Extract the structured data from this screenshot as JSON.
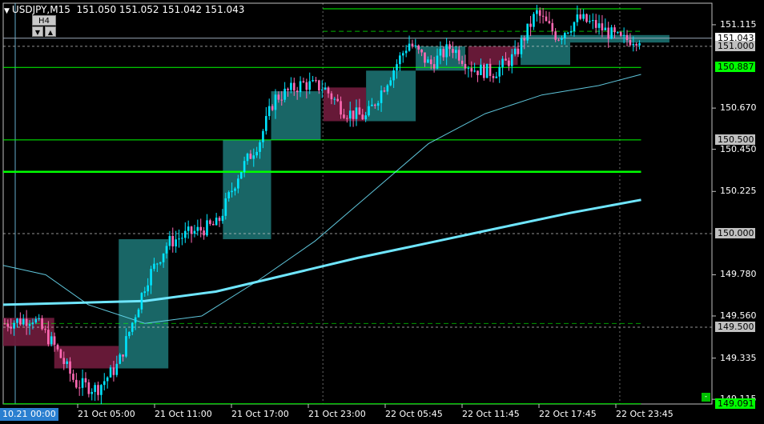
{
  "header": {
    "symbol_tf": "USDJPY,M15",
    "ohlc": "151.050 151.052 151.042 151.043"
  },
  "tf_panel": {
    "tf": "H4",
    "down": "▼",
    "up": "▲"
  },
  "price_axis": {
    "ticks": [
      "151.115",
      "150.670",
      "150.450",
      "150.225",
      "149.780",
      "149.560",
      "149.335",
      "149.115"
    ],
    "boxes": [
      {
        "text": "151.043",
        "fg": "#000000",
        "bg": "#ffffff"
      },
      {
        "text": "151.000",
        "fg": "#000000",
        "bg": "#c0c0c0"
      },
      {
        "text": "150.887",
        "fg": "#000000",
        "bg": "#00ff00"
      },
      {
        "text": "150.500",
        "fg": "#000000",
        "bg": "#c0c0c0"
      },
      {
        "text": "150.000",
        "fg": "#000000",
        "bg": "#c0c0c0"
      },
      {
        "text": "149.500",
        "fg": "#000000",
        "bg": "#c0c0c0"
      },
      {
        "text": "149.091",
        "fg": "#000000",
        "bg": "#00ff00"
      }
    ]
  },
  "time_axis": {
    "current": "10.21 00:00",
    "labels": [
      "21 Oct 05:00",
      "21 Oct 11:00",
      "21 Oct 17:00",
      "21 Oct 23:00",
      "22 Oct 05:45",
      "22 Oct 11:45",
      "22 Oct 17:45",
      "22 Oct 23:45"
    ]
  },
  "corner_button": "-",
  "colors": {
    "bull": "#00e5ff",
    "bear": "#ff69b4",
    "h4_bull": "#1a6b6b",
    "h4_bear": "#6b1a3a",
    "level": "#00ff00",
    "ma": "#6fe6ff"
  },
  "chart_data": {
    "type": "candlestick",
    "symbol": "USDJPY",
    "timeframe": "M15",
    "ylim": [
      149.09,
      151.23
    ],
    "last_price": 151.043,
    "horizontal_levels": [
      151.2,
      151.0,
      150.887,
      150.5,
      150.33,
      150.0,
      149.5,
      149.091
    ],
    "h4_boxes": [
      {
        "x0": 0.0,
        "x1": 0.072,
        "open": 149.55,
        "close": 149.4,
        "dir": "bear"
      },
      {
        "x0": 0.072,
        "x1": 0.163,
        "open": 149.4,
        "close": 149.28,
        "dir": "bear"
      },
      {
        "x0": 0.163,
        "x1": 0.233,
        "open": 149.28,
        "close": 149.97,
        "dir": "bull"
      },
      {
        "x0": 0.31,
        "x1": 0.378,
        "open": 149.97,
        "close": 150.5,
        "dir": "bull"
      },
      {
        "x0": 0.378,
        "x1": 0.448,
        "open": 150.5,
        "close": 150.76,
        "dir": "bull"
      },
      {
        "x0": 0.452,
        "x1": 0.512,
        "open": 150.78,
        "close": 150.6,
        "dir": "bear"
      },
      {
        "x0": 0.512,
        "x1": 0.582,
        "open": 150.6,
        "close": 150.87,
        "dir": "bull"
      },
      {
        "x0": 0.582,
        "x1": 0.652,
        "open": 150.87,
        "close": 151.0,
        "dir": "bull"
      },
      {
        "x0": 0.656,
        "x1": 0.726,
        "open": 151.0,
        "close": 150.9,
        "dir": "bear"
      },
      {
        "x0": 0.73,
        "x1": 0.8,
        "open": 150.9,
        "close": 151.06,
        "dir": "bull"
      },
      {
        "x0": 0.8,
        "x1": 0.94,
        "open": 151.06,
        "close": 151.02,
        "dir": "bull"
      }
    ],
    "ma_slow": [
      [
        0.0,
        149.62
      ],
      [
        0.1,
        149.63
      ],
      [
        0.2,
        149.64
      ],
      [
        0.3,
        149.69
      ],
      [
        0.4,
        149.78
      ],
      [
        0.5,
        149.87
      ],
      [
        0.6,
        149.95
      ],
      [
        0.7,
        150.03
      ],
      [
        0.8,
        150.11
      ],
      [
        0.9,
        150.18
      ]
    ],
    "ma_mid": [
      [
        0.0,
        149.83
      ],
      [
        0.06,
        149.78
      ],
      [
        0.12,
        149.62
      ],
      [
        0.2,
        149.52
      ],
      [
        0.28,
        149.56
      ],
      [
        0.36,
        149.75
      ],
      [
        0.44,
        149.96
      ],
      [
        0.52,
        150.22
      ],
      [
        0.6,
        150.48
      ],
      [
        0.68,
        150.64
      ],
      [
        0.76,
        150.74
      ],
      [
        0.84,
        150.79
      ],
      [
        0.9,
        150.85
      ]
    ]
  }
}
